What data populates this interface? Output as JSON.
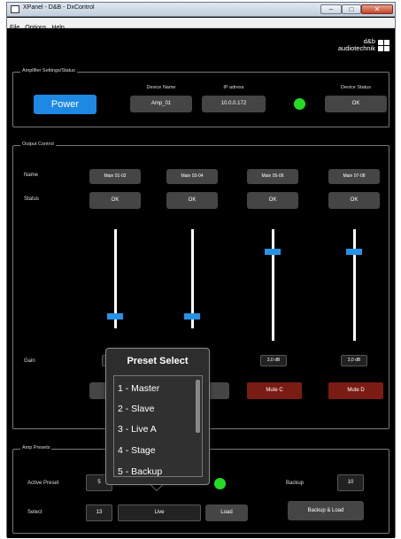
{
  "window": {
    "title": "XPanel - D&B - DxControl",
    "min": "–",
    "max": "□",
    "close": "✕"
  },
  "menu": [
    "File",
    "Options",
    "Help"
  ],
  "logo": {
    "line1": "d&b",
    "line2": "audiotechnik"
  },
  "amp_settings": {
    "legend": "Amplifier Settings/Status",
    "power_label": "Power",
    "device_name_header": "Device Name",
    "device_name": "Amp_01",
    "ip_header": "IP adress",
    "ip": "10.0.0.172",
    "device_status_header": "Device Status",
    "device_status": "OK"
  },
  "output": {
    "legend": "Output Control",
    "name_label": "Name",
    "status_label": "Status",
    "gain_label": "Gain",
    "channels": [
      {
        "name": "Main 01-02",
        "status": "OK",
        "gain": "",
        "mute": "",
        "fader_level": 0.0
      },
      {
        "name": "Main 03-04",
        "status": "OK",
        "gain": "",
        "mute": "",
        "fader_level": 0.0
      },
      {
        "name": "Main 05-06",
        "status": "OK",
        "gain": "3,0 dB",
        "mute": "Mute C",
        "fader_level": 0.75
      },
      {
        "name": "Main 07-08",
        "status": "OK",
        "gain": "3,0 dB",
        "mute": "Mute D",
        "fader_level": 0.75
      }
    ],
    "mute_color": "#7a1c14",
    "fader_color": "#2792e5"
  },
  "presets": {
    "legend": "Amp Presets",
    "active_label": "Active Preset",
    "active_value": "5",
    "backup_label": "Backup",
    "backup_value": "10",
    "select_label": "Select",
    "select_value": "13",
    "select_name": "Live",
    "load_label": "Load",
    "backup_load_label": "Backup & Load"
  },
  "popup": {
    "title": "Preset Select",
    "items": [
      "1 - Master",
      "2 - Slave",
      "3 - Live A",
      "4 - Stage",
      "5 - Backup"
    ]
  },
  "colors": {
    "accent": "#1e88e5",
    "led": "#22dd22",
    "background": "#000000"
  }
}
